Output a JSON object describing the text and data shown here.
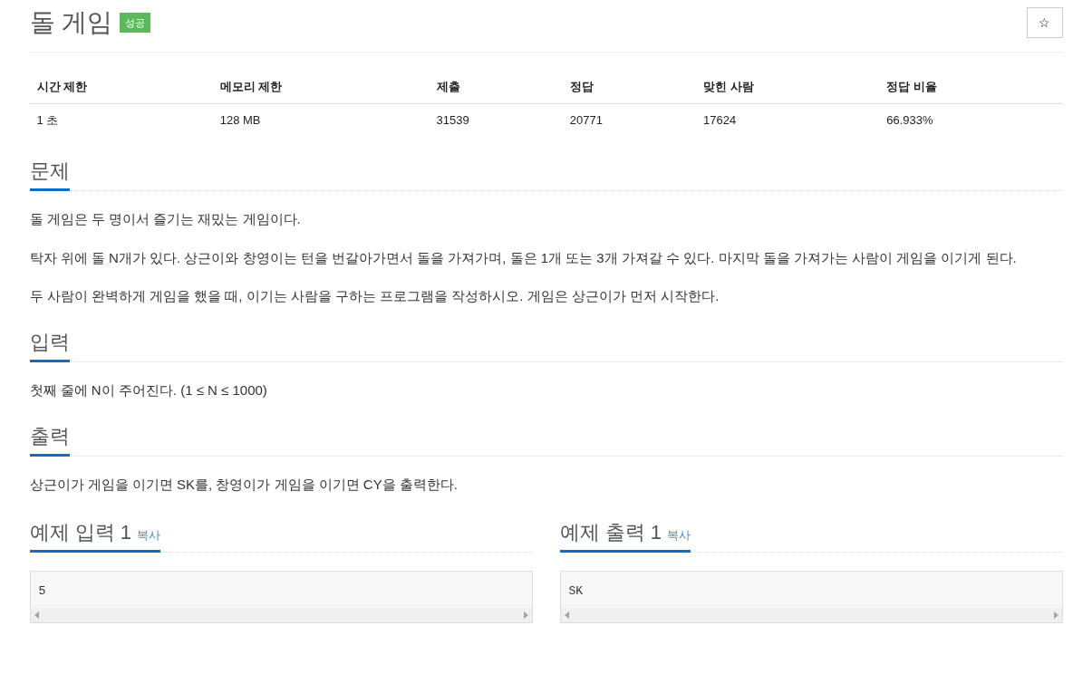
{
  "title": "돌 게임",
  "badge": {
    "label": "성공",
    "kind": "success"
  },
  "star_button": {
    "label": "☆"
  },
  "stats": {
    "columns": [
      "시간 제한",
      "메모리 제한",
      "제출",
      "정답",
      "맞힌 사람",
      "정답 비율"
    ],
    "rows": [
      [
        "1 초",
        "128 MB",
        "31539",
        "20771",
        "17624",
        "66.933%"
      ]
    ]
  },
  "sections": [
    {
      "heading": "문제",
      "paragraphs": [
        "돌 게임은 두 명이서 즐기는 재밌는 게임이다.",
        "탁자 위에 돌 N개가 있다. 상근이와 창영이는 턴을 번갈아가면서 돌을 가져가며, 돌은 1개 또는 3개 가져갈 수 있다. 마지막 돌을 가져가는 사람이 게임을 이기게 된다.",
        "두 사람이 완벽하게 게임을 했을 때, 이기는 사람을 구하는 프로그램을 작성하시오. 게임은 상근이가 먼저 시작한다."
      ]
    },
    {
      "heading": "입력",
      "paragraphs": [
        "첫째 줄에 N이 주어진다. (1 ≤ N ≤ 1000)"
      ]
    },
    {
      "heading": "출력",
      "paragraphs": [
        "상근이가 게임을 이기면 SK를, 창영이가 게임을 이기면 CY을 출력한다."
      ]
    }
  ],
  "samples": [
    {
      "heading": "예제 입력 1",
      "copy_label": "복사",
      "content": "5"
    },
    {
      "heading": "예제 출력 1",
      "copy_label": "복사",
      "content": "SK"
    }
  ]
}
